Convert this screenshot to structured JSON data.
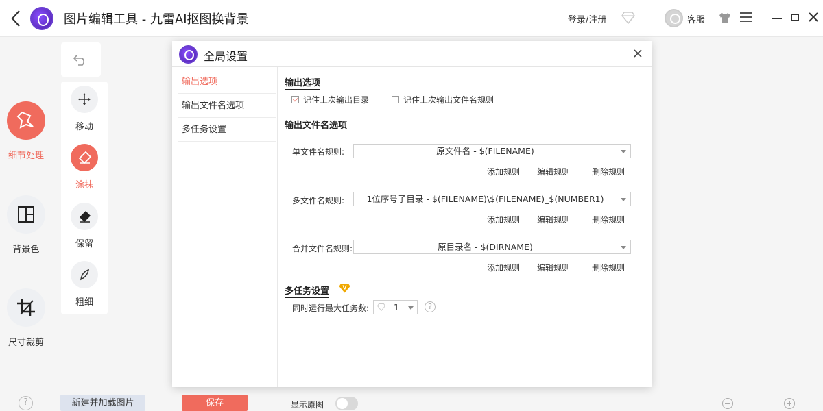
{
  "titlebar": {
    "app_title": "图片编辑工具 - 九雷AI抠图换背景",
    "login_label": "登录/注册",
    "service_label": "客服"
  },
  "sidebar": {
    "items": [
      {
        "label": "细节处理",
        "active": true
      },
      {
        "label": "背景色"
      },
      {
        "label": "尺寸裁剪"
      }
    ]
  },
  "tools": {
    "items": [
      {
        "label": "移动"
      },
      {
        "label": "涂抹",
        "active": true
      },
      {
        "label": "保留"
      },
      {
        "label": "粗细"
      }
    ]
  },
  "bottom": {
    "help_glyph": "?",
    "new_load_label": "新建并加载图片",
    "save_label": "保存",
    "show_original_label": "显示原图"
  },
  "dialog": {
    "title": "全局设置",
    "nav": [
      {
        "label": "输出选项",
        "active": true
      },
      {
        "label": "输出文件名选项"
      },
      {
        "label": "多任务设置"
      }
    ],
    "output_options": {
      "title": "输出选项",
      "remember_dir_label": "记住上次输出目录",
      "remember_dir_checked": true,
      "remember_rule_label": "记住上次输出文件名规则",
      "remember_rule_checked": false
    },
    "filename_options": {
      "title": "输出文件名选项",
      "rules": [
        {
          "label": "单文件名规则:",
          "value": "原文件名 - $(FILENAME)"
        },
        {
          "label": "多文件名规则:",
          "value": "1位序号子目录 - $(FILENAME)\\$(FILENAME)_$(NUMBER1)"
        },
        {
          "label": "合并文件名规则:",
          "value": "原目录名 - $(DIRNAME)"
        }
      ],
      "add_label": "添加规则",
      "edit_label": "编辑规则",
      "delete_label": "删除规则"
    },
    "multitask": {
      "title": "多任务设置",
      "badge": "V",
      "max_tasks_label": "同时运行最大任务数:",
      "max_tasks_value": "1",
      "help_glyph": "?"
    }
  },
  "colors": {
    "accent": "#f06b5d",
    "vip": "#f0a800"
  }
}
